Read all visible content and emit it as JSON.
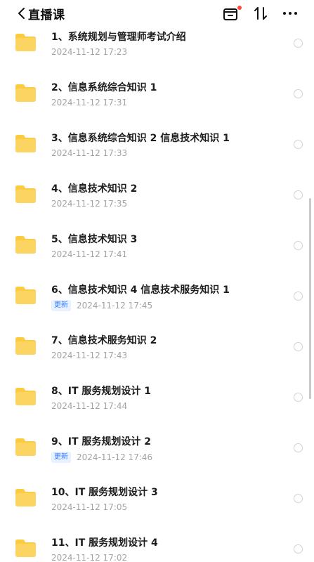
{
  "header": {
    "back_icon": "chevron-left-icon",
    "title": "直播课",
    "icons": [
      "inbox-icon",
      "sort-icon",
      "more-icon"
    ]
  },
  "items": [
    {
      "title": "1、系统规划与管理师考试介绍",
      "date": "2024-11-12 17:23",
      "badge": ""
    },
    {
      "title": "2、信息系统综合知识 1",
      "date": "2024-11-12 17:31",
      "badge": ""
    },
    {
      "title": "3、信息系统综合知识 2 信息技术知识 1",
      "date": "2024-11-12 17:33",
      "badge": ""
    },
    {
      "title": "4、信息技术知识 2",
      "date": "2024-11-12 17:35",
      "badge": ""
    },
    {
      "title": "5、信息技术知识 3",
      "date": "2024-11-12 17:41",
      "badge": ""
    },
    {
      "title": "6、信息技术知识 4 信息技术服务知识 1",
      "date": "2024-11-12 17:45",
      "badge": "更新"
    },
    {
      "title": "7、信息技术服务知识 2",
      "date": "2024-11-12 17:43",
      "badge": ""
    },
    {
      "title": "8、IT 服务规划设计 1",
      "date": "2024-11-12 17:44",
      "badge": ""
    },
    {
      "title": "9、IT 服务规划设计 2",
      "date": "2024-11-12 17:46",
      "badge": "更新"
    },
    {
      "title": "10、IT 服务规划设计 3",
      "date": "2024-11-12 17:05",
      "badge": ""
    },
    {
      "title": "11、IT 服务规划设计 4",
      "date": "2024-11-12 17:02",
      "badge": ""
    }
  ],
  "colors": {
    "folder": "#fccb3f",
    "folder_light": "#fde08a",
    "badge_text": "#2f7bff",
    "badge_bg": "#e8f1ff",
    "notification_dot": "#ff4a3d"
  }
}
